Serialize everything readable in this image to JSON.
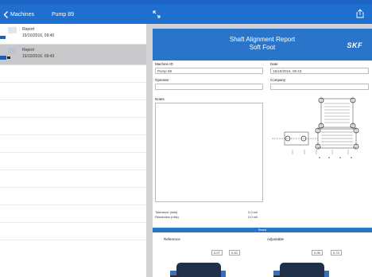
{
  "nav": {
    "back_label": "Machines",
    "title": "Pump 89"
  },
  "reports": [
    {
      "title": "Report",
      "date": "15/10/2016, 09:40"
    },
    {
      "title": "Report",
      "date": "15/10/2016, 09:43"
    }
  ],
  "report": {
    "title": "Shaft Alignment Report",
    "subtitle": "Soft Foot",
    "logo": "SKF",
    "machine_id_label": "Machine ID",
    "machine_id_value": "Pump 89",
    "date_label": "Date",
    "date_value": "15/10/2016, 09:43",
    "operator_label": "Operator",
    "operator_value": "",
    "company_label": "Company",
    "company_value": "",
    "notes_label": "Notes",
    "tolerance_label": "Tolerance (mils)",
    "tolerance_value": "2.0 mil",
    "resolution_label": "Resolution (mils)",
    "resolution_value": "2.0 mil",
    "section_label": "Result",
    "left_label": "Reference",
    "right_label": "Adjustable",
    "left_readouts": [
      "0.07",
      "0.40"
    ],
    "right_readouts": [
      "0.05",
      "0.74"
    ]
  },
  "colors": {
    "accent": "#2a75c9",
    "nav": "#1f6fcf"
  }
}
